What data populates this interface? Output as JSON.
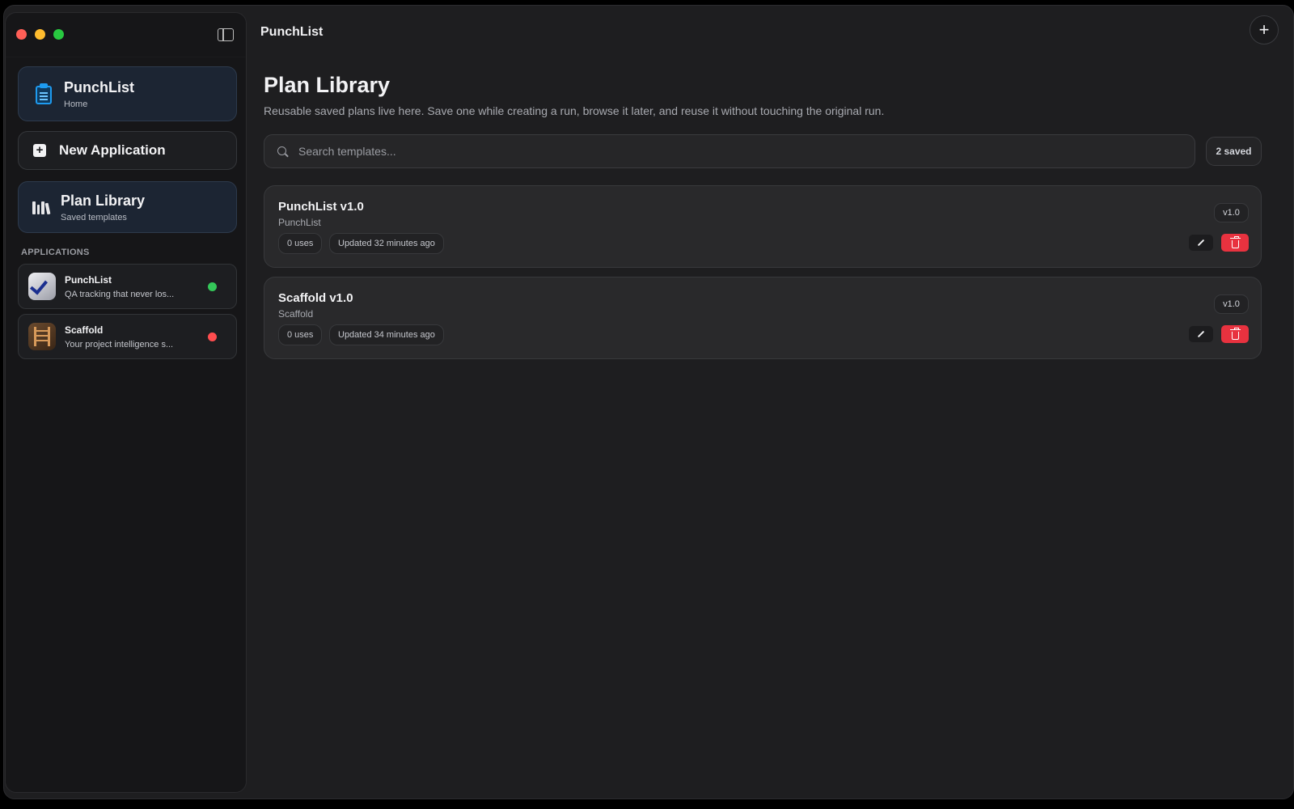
{
  "window": {
    "title": "PunchList",
    "add_icon": "plus-icon"
  },
  "sidebar": {
    "toggle_icon": "sidebar-toggle-icon",
    "home": {
      "title": "PunchList",
      "subtitle": "Home",
      "icon": "clipboard-icon"
    },
    "new_application": {
      "label": "New Application",
      "icon": "plus-square-icon"
    },
    "plan_library": {
      "title": "Plan Library",
      "subtitle": "Saved templates",
      "icon": "library-icon"
    },
    "applications_heading": "APPLICATIONS",
    "applications": [
      {
        "name": "PunchList",
        "description": "QA tracking that never los...",
        "status": "active",
        "status_color": "#34c759"
      },
      {
        "name": "Scaffold",
        "description": "Your project intelligence s...",
        "status": "inactive",
        "status_color": "#ff4d4f"
      }
    ]
  },
  "main": {
    "title": "Plan Library",
    "description": "Reusable saved plans live here. Save one while creating a run, browse it later, and reuse it without touching the original run.",
    "search": {
      "placeholder": "Search templates...",
      "value": ""
    },
    "saved_count": "2 saved",
    "plans": [
      {
        "title": "PunchList v1.0",
        "app": "PunchList",
        "uses": "0 uses",
        "updated": "Updated 32 minutes ago",
        "version": "v1.0"
      },
      {
        "title": "Scaffold v1.0",
        "app": "Scaffold",
        "uses": "0 uses",
        "updated": "Updated 34 minutes ago",
        "version": "v1.0"
      }
    ]
  },
  "colors": {
    "accent": "#1e9bf0",
    "danger": "#e8323f",
    "background": "#1e1e20"
  }
}
